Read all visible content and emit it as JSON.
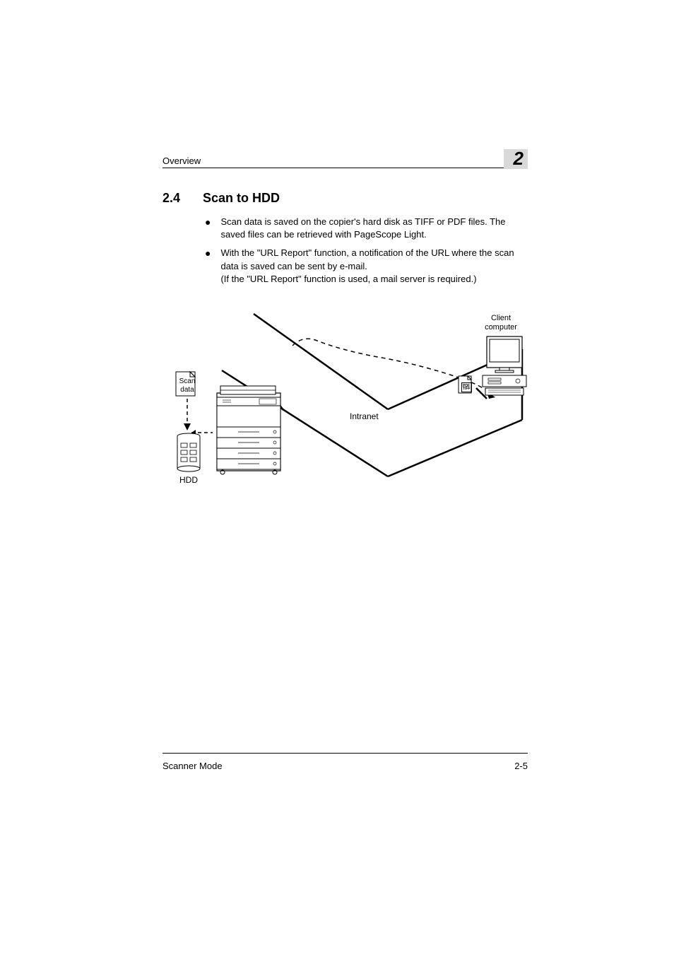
{
  "header": {
    "label": "Overview",
    "chapter": "2"
  },
  "section": {
    "number": "2.4",
    "title": "Scan to HDD"
  },
  "bullets": [
    "Scan data is saved on the copier's hard disk as TIFF or PDF files. The saved files can be retrieved with PageScope Light.",
    "With the \"URL Report\" function, a notification of the URL where the scan data is saved can be sent by e-mail.\n(If the \"URL Report\" function is used, a mail server is required.)"
  ],
  "diagram": {
    "client_label": "Client computer",
    "scan_label": "Scan data",
    "intranet_label": "Intranet",
    "hdd_label": "HDD",
    "file_format_label": "PDF\nTIFF"
  },
  "footer": {
    "left": "Scanner Mode",
    "right": "2-5"
  }
}
